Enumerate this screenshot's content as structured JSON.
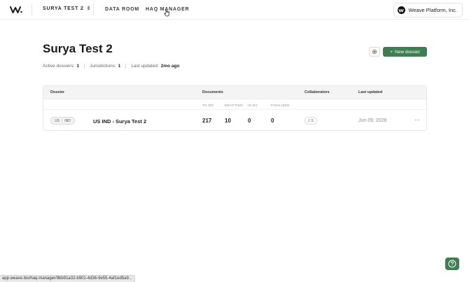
{
  "topbar": {
    "project_name": "SURYA TEST 2",
    "nav": {
      "data_room": "DATA ROOM",
      "haq_manager": "HAQ MANAGER"
    },
    "org_name": "Weave Platform, Inc."
  },
  "header": {
    "title": "Surya Test 2",
    "stats": {
      "active_label": "Active dossiers:",
      "active_value": "1",
      "juris_label": "Jurisdictions:",
      "juris_value": "1",
      "updated_label": "Last updated:",
      "updated_value": "2mo ago"
    },
    "new_button": "New dossier"
  },
  "table": {
    "headers": {
      "dossier": "Dossier",
      "documents": "Documents",
      "collaborators": "Collaborators",
      "last_updated": "Last updated"
    },
    "doc_subheaders": [
      "TO DO",
      "DRAFTING",
      "IN DV",
      "FINALIZED"
    ],
    "rows": [
      {
        "tag_a": "US",
        "tag_b": "IND",
        "name": "US IND - Surya Test 2",
        "todo": "217",
        "drafting": "10",
        "in_dv": "0",
        "finalized": "0",
        "collab_a": "J",
        "collab_b": "S",
        "updated": "Jun 09, 2026"
      }
    ]
  },
  "statusbar": {
    "url": "app.weave.bio/haq-manager/9bb91a32-b901-4d36-9e55-4af1ed5a9..."
  },
  "colors": {
    "accent": "#3f7d52"
  }
}
